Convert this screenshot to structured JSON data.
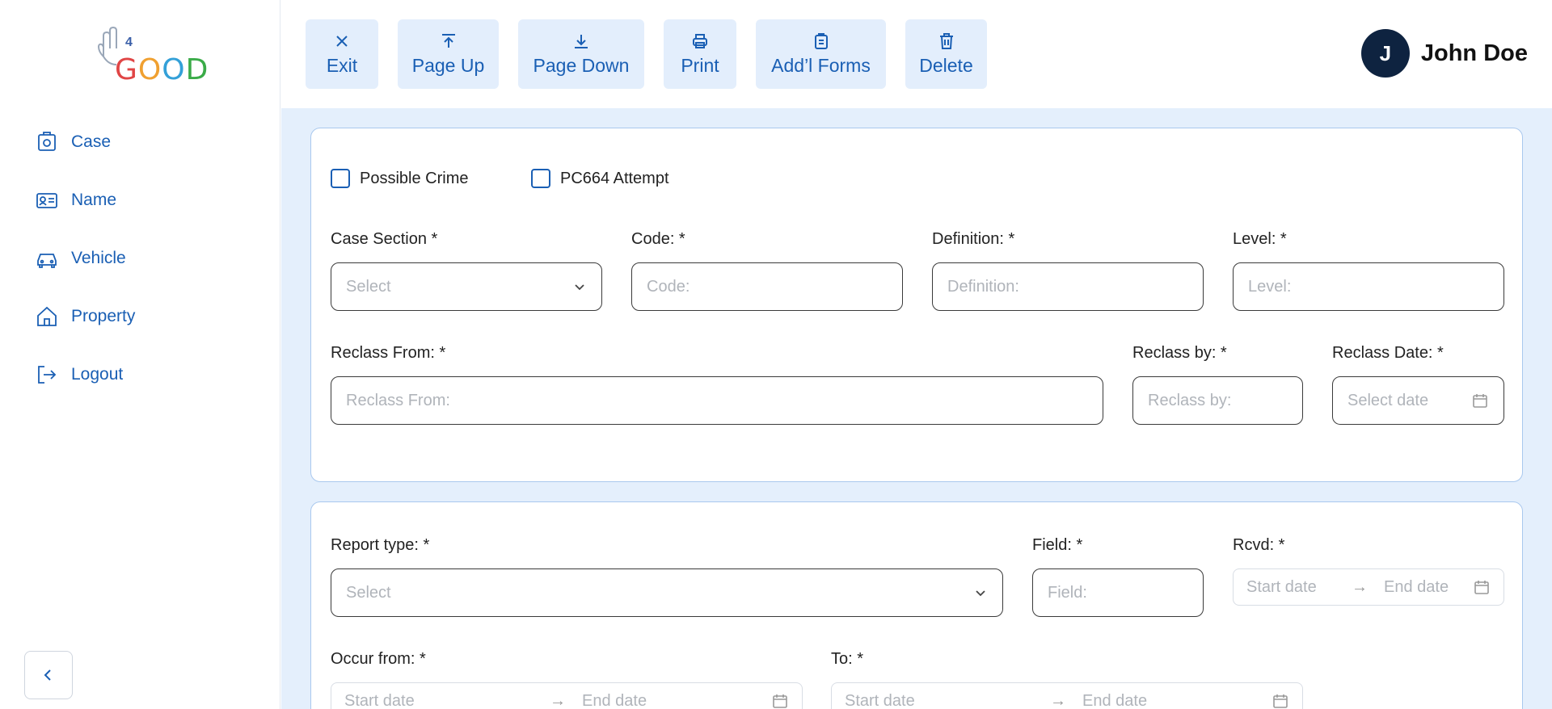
{
  "brand": {
    "four": "4",
    "good_letters": [
      "G",
      "O",
      "O",
      "D"
    ]
  },
  "sidebar": {
    "items": [
      {
        "label": "Case",
        "icon": "case-icon"
      },
      {
        "label": "Name",
        "icon": "id-card-icon"
      },
      {
        "label": "Vehicle",
        "icon": "car-icon"
      },
      {
        "label": "Property",
        "icon": "house-icon"
      },
      {
        "label": "Logout",
        "icon": "logout-icon"
      }
    ],
    "collapse_icon": "chevron-left-icon"
  },
  "toolbar": {
    "exit": "Exit",
    "page_up": "Page Up",
    "page_down": "Page Down",
    "print": "Print",
    "addl_forms": "Add’l Forms",
    "delete": "Delete"
  },
  "user": {
    "initial": "J",
    "name": "John Doe"
  },
  "form1": {
    "possible_crime": "Possible Crime",
    "pc664": "PC664 Attempt",
    "case_section_label": "Case Section *",
    "case_section_placeholder": "Select",
    "code_label": "Code: *",
    "code_placeholder": "Code:",
    "definition_label": "Definition: *",
    "definition_placeholder": "Definition:",
    "level_label": "Level: *",
    "level_placeholder": "Level:",
    "reclass_from_label": "Reclass From: *",
    "reclass_from_placeholder": "Reclass From:",
    "reclass_by_label": "Reclass by: *",
    "reclass_by_placeholder": "Reclass by:",
    "reclass_date_label": "Reclass Date: *",
    "reclass_date_placeholder": "Select date"
  },
  "form2": {
    "report_type_label": "Report type: *",
    "report_type_placeholder": "Select",
    "field_label": "Field: *",
    "field_placeholder": "Field:",
    "rcvd_label": "Rcvd: *",
    "start_date": "Start date",
    "end_date": "End date",
    "arrow": "→",
    "occur_from_label": "Occur from: *",
    "to_label": "To: *"
  }
}
